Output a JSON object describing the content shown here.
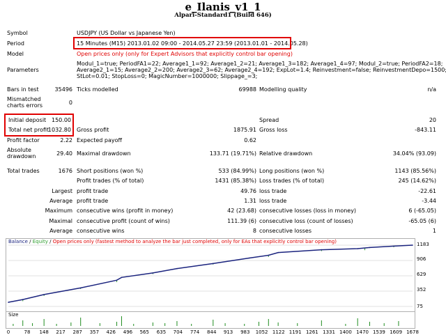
{
  "header": {
    "title": "e_Ilanis_v1_1",
    "subtitle": "Alpari-Standard1 (Build 646)"
  },
  "info": {
    "symbol_label": "Symbol",
    "symbol_value": "USDJPY (US Dollar vs Japanese Yen)",
    "period_label": "Period",
    "period_value": "15 Minutes (M15) 2013.01.02 09:00 - 2014.05.27 23:59 (2013.01.01 - 2014.05.28)",
    "model_label": "Model",
    "model_value": "Open prices only (only for Expert Advisors that explicitly control bar opening)",
    "parameters_label": "Parameters",
    "parameters_line1": "Modul_1=true; PeriodFA1=22; Average1_1=92; Average1_2=21; Average1_3=182; Average1_4=97; Modul_2=true; PeriodFA2=18;",
    "parameters_line2": "Average2_1=15; Average2_2=200; Average2_3=62; Average2_4=192; ExpLot=1.4; Reinvestment=false; ReinvestmentDepo=1500;",
    "parameters_line3": "StLot=0.01; StopLoss=0; MagicNumber=1000000; Slippage_=3;"
  },
  "stats": {
    "bars_label": "Bars in test",
    "bars_value": "35496",
    "ticks_label": "Ticks modelled",
    "ticks_value": "69988",
    "quality_label": "Modelling quality",
    "quality_value": "n/a",
    "mismatched_label1": "Mismatched",
    "mismatched_label2": "charts errors",
    "mismatched_value": "0",
    "deposit_label": "Initial deposit",
    "deposit_value": "150.00",
    "spread_label": "Spread",
    "spread_value": "20",
    "netprofit_label": "Total net profit",
    "netprofit_value": "1032.80",
    "grossprofit_label": "Gross profit",
    "grossprofit_value": "1875.91",
    "grossloss_label": "Gross loss",
    "grossloss_value": "-843.11",
    "pf_label": "Profit factor",
    "pf_value": "2.22",
    "payoff_label": "Expected payoff",
    "payoff_value": "0.62",
    "absdd_label1": "Absolute",
    "absdd_label2": "drawdown",
    "absdd_value": "29.40",
    "maxdd_label": "Maximal drawdown",
    "maxdd_value": "133.71 (19.71%)",
    "reldd_label": "Relative drawdown",
    "reldd_value": "34.04% (93.09)",
    "trades_label": "Total trades",
    "trades_value": "1676",
    "short_label": "Short positions (won %)",
    "short_value": "533 (84.99%)",
    "long_label": "Long positions (won %)",
    "long_value": "1143 (85.56%)",
    "ptrades_label": "Profit trades (% of total)",
    "ptrades_value": "1431 (85.38%)",
    "ltrades_label": "Loss trades (% of total)",
    "ltrades_value": "245 (14.62%)",
    "largest_label": "Largest",
    "largest_p_label": "profit trade",
    "largest_p_value": "49.76",
    "largest_l_label": "loss trade",
    "largest_l_value": "-22.61",
    "average_label": "Average",
    "average_p_label": "profit trade",
    "average_p_value": "1.31",
    "average_l_label": "loss trade",
    "average_l_value": "-3.44",
    "maximum_label": "Maximum",
    "maximum_w_label": "consecutive wins (profit in money)",
    "maximum_w_value": "42 (23.68)",
    "maximum_l_label": "consecutive losses (loss in money)",
    "maximum_l_value": "6 (-65.05)",
    "maximal_label": "Maximal",
    "maximal_p_label": "consecutive profit (count of wins)",
    "maximal_p_value": "111.39 (6)",
    "maximal_l_label": "consecutive loss (count of losses)",
    "maximal_l_value": "-65.05 (6)",
    "avg2_label": "Average",
    "avg2_w_label": "consecutive wins",
    "avg2_w_value": "8",
    "avg2_l_label": "consecutive losses",
    "avg2_l_value": "1"
  },
  "chart": {
    "legend_balance": "Balance",
    "legend_sep1": " / ",
    "legend_equity": "Equity",
    "legend_sep2": " / ",
    "legend_note": "Open prices only (fastest method to analyze the bar just completed, only for EAs that explicitly control bar opening)",
    "size_label": "Size",
    "colors": {
      "balance": "#1a237e",
      "equity": "#2e9e2e",
      "legend_red": "#e00000",
      "size_bars": "#1e8c1e"
    }
  },
  "chart_data": {
    "type": "line",
    "title": "",
    "xlabel": "",
    "ylabel": "",
    "ylim": [
      75,
      1183
    ],
    "xlim": [
      0,
      1678
    ],
    "yticks": [
      1183,
      906,
      629,
      352,
      75
    ],
    "xticks": [
      0,
      78,
      148,
      217,
      287,
      357,
      426,
      496,
      565,
      635,
      704,
      774,
      844,
      913,
      983,
      1052,
      1122,
      1191,
      1261,
      1331,
      1400,
      1470,
      1539,
      1609,
      1678
    ],
    "series": [
      {
        "x": [
          0,
          60,
          148,
          300,
          450,
          470,
          600,
          700,
          850,
          1000,
          1080,
          1120,
          1300,
          1450,
          1500,
          1600,
          1678
        ],
        "values": [
          150,
          200,
          290,
          410,
          550,
          600,
          680,
          760,
          850,
          950,
          1000,
          1050,
          1100,
          1120,
          1140,
          1165,
          1183
        ]
      }
    ]
  }
}
